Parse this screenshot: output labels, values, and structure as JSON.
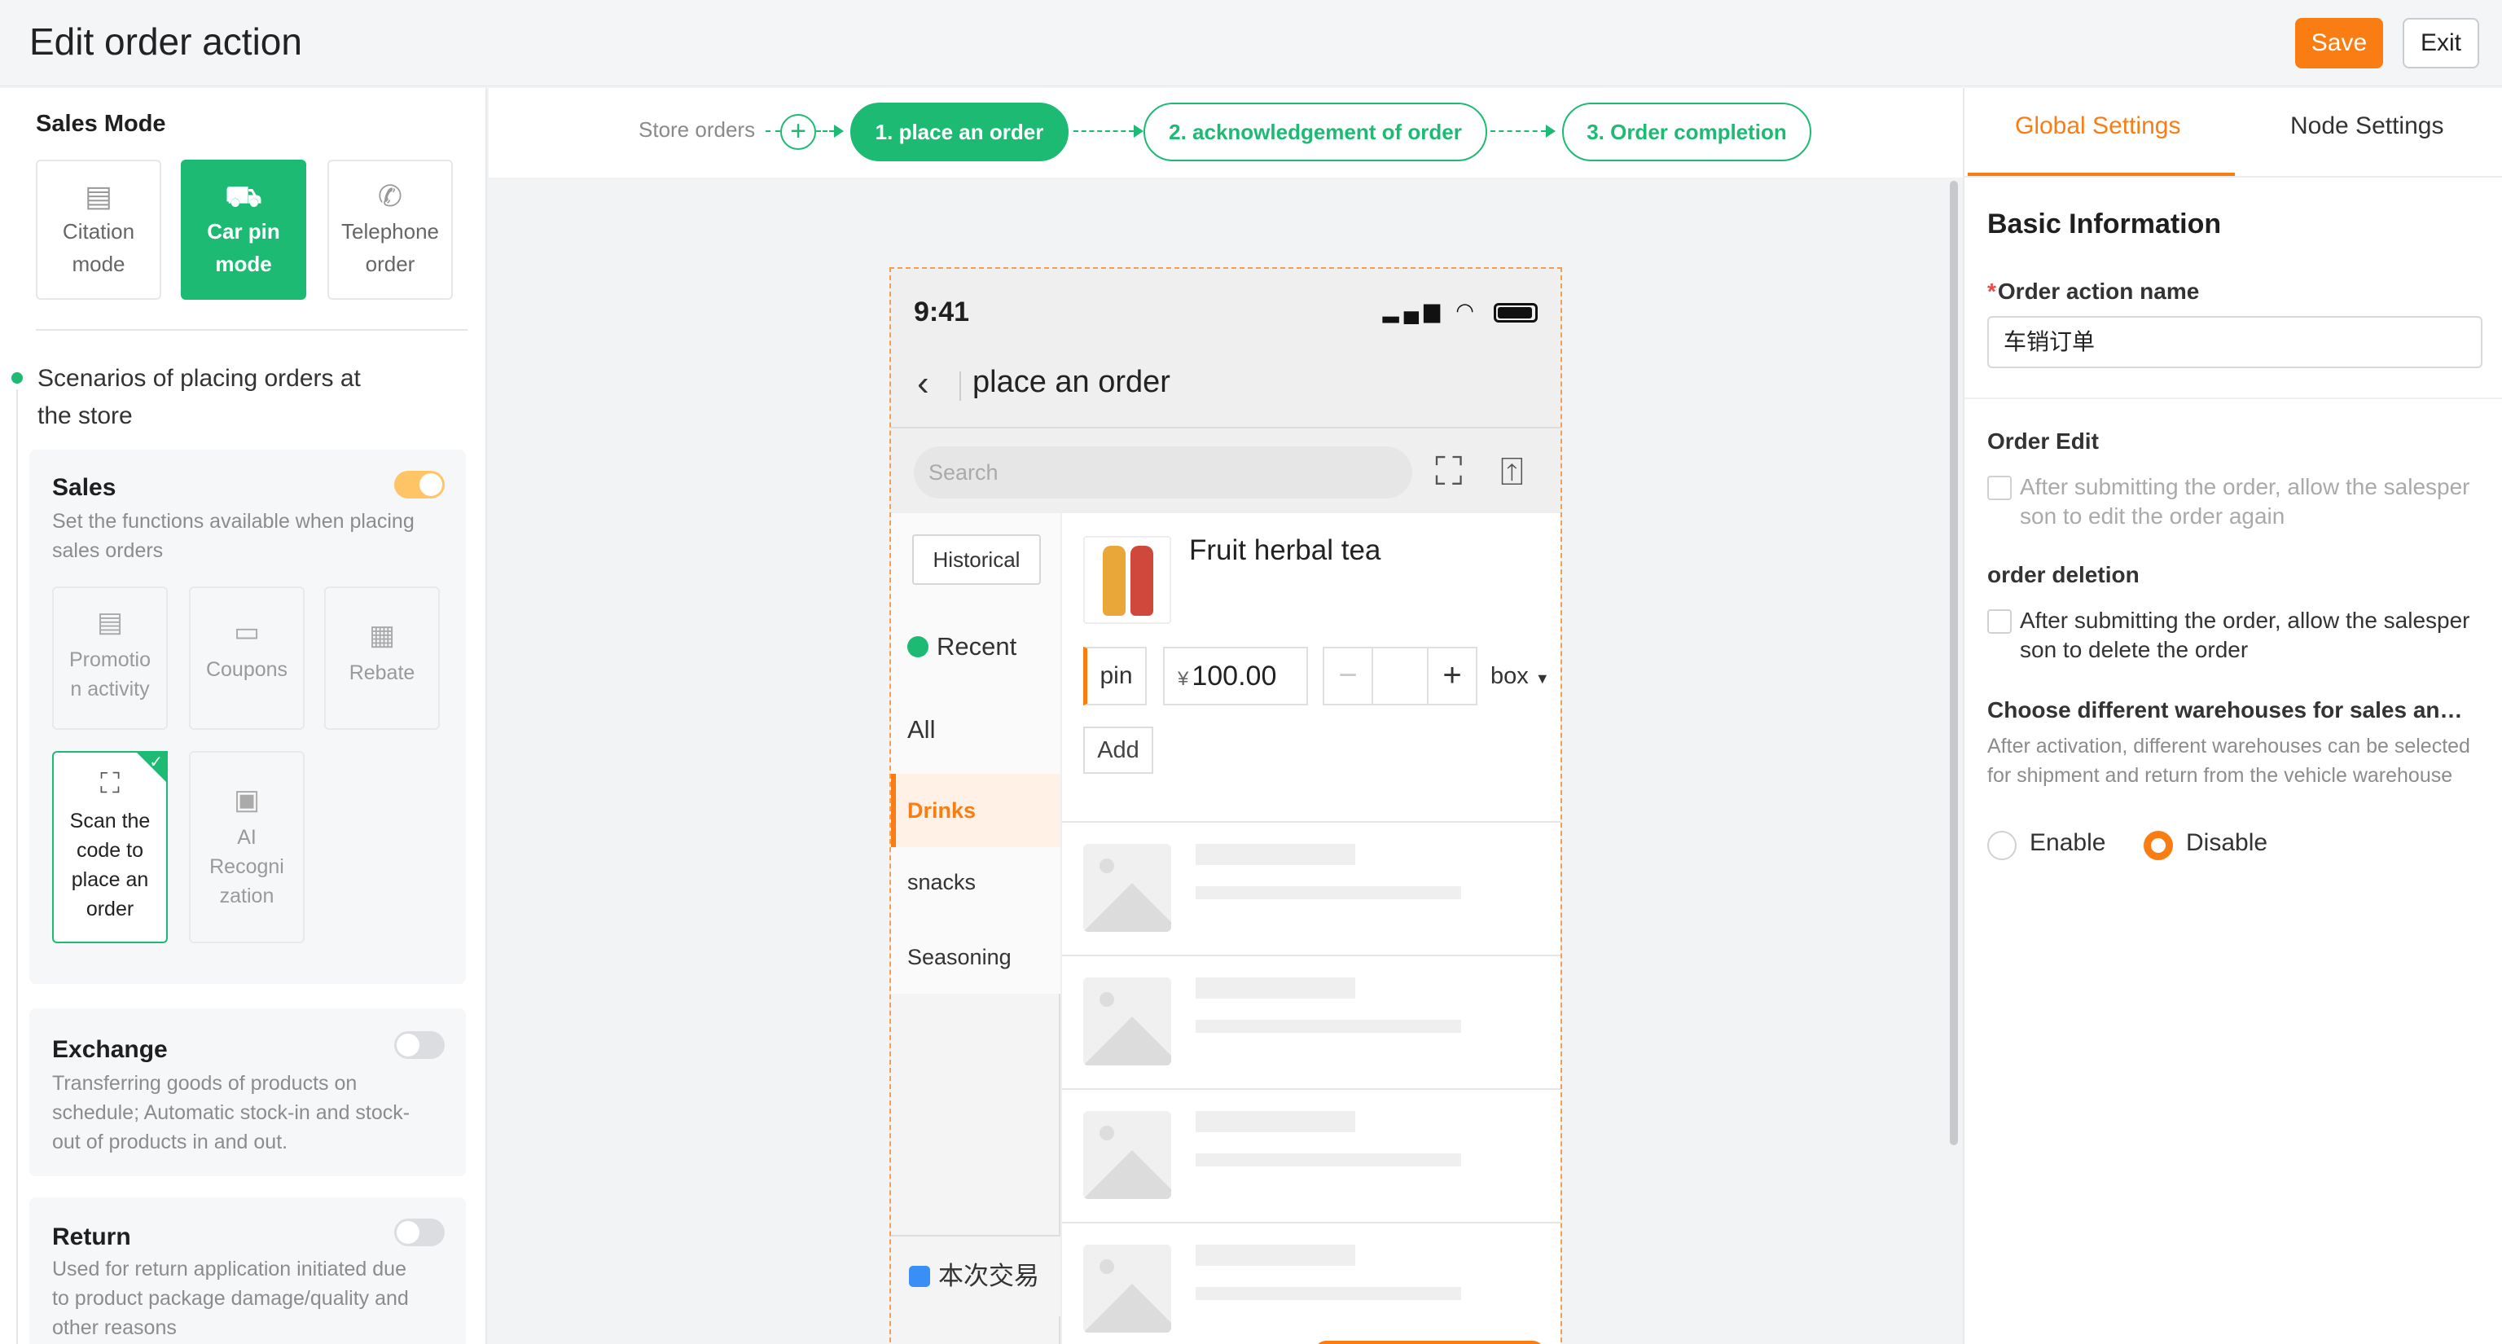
{
  "header": {
    "title": "Edit order action",
    "save_label": "Save",
    "exit_label": "Exit"
  },
  "left": {
    "sales_mode_title": "Sales Mode",
    "modes": [
      {
        "line1": "Citation",
        "line2": "mode",
        "icon": "clipboard-icon"
      },
      {
        "line1": "Car pin",
        "line2": "mode",
        "icon": "truck-icon"
      },
      {
        "line1": "Telephone",
        "line2": "order",
        "icon": "phone-icon"
      }
    ],
    "scenario_line1": "Scenarios of placing orders at",
    "scenario_line2": "the store",
    "sales": {
      "title": "Sales",
      "desc1": "Set the functions available when placing",
      "desc2": "sales orders",
      "enabled": true,
      "features": [
        {
          "line1": "Promotio",
          "line2": "n activity"
        },
        {
          "line1": "Coupons"
        },
        {
          "line1": "Rebate"
        },
        {
          "line1": "Scan the",
          "line2": "code to",
          "line3": "place an",
          "line4": "order"
        },
        {
          "line1": "AI",
          "line2": "Recogni",
          "line3": "zation"
        }
      ]
    },
    "exchange": {
      "title": "Exchange",
      "desc1": "Transferring goods of products on",
      "desc2": "schedule; Automatic stock-in and stock-",
      "desc3": "out of products in and out.",
      "enabled": false
    },
    "return": {
      "title": "Return",
      "desc1": "Used for return application initiated due",
      "desc2": "to product package damage/quality and",
      "desc3": "other reasons",
      "enabled": false
    }
  },
  "steps": {
    "start_label": "Store orders",
    "items": [
      "1. place an order",
      "2. acknowledgement of order",
      "3. Order completion"
    ]
  },
  "phone": {
    "time": "9:41",
    "title": "place an order",
    "search_placeholder": "Search",
    "historical": "Historical",
    "recent": "Recent",
    "all": "All",
    "categories": [
      "Drinks",
      "snacks",
      "Seasoning"
    ],
    "trade_label": "本次交易",
    "product": {
      "name": "Fruit herbal tea",
      "unit": "pin",
      "currency": "¥",
      "price": "100.00",
      "pack": "box",
      "add_label": "Add"
    }
  },
  "right": {
    "tabs": [
      "Global Settings",
      "Node Settings"
    ],
    "basic_info": "Basic Information",
    "order_action_label": "Order action name",
    "order_action_value": "车销订单",
    "order_edit_label": "Order Edit",
    "order_edit_line1": "After submitting the order, allow the salesper",
    "order_edit_line2": "son to edit the order again",
    "order_del_label": "order deletion",
    "order_del_line1": "After submitting the order, allow the salesper",
    "order_del_line2": "son to delete the order",
    "warehouse_label": "Choose different warehouses for sales an…",
    "warehouse_desc": "After activation, different warehouses can be selected for shipment and return from the vehicle warehouse",
    "enable": "Enable",
    "disable": "Disable",
    "selected": "Disable"
  }
}
